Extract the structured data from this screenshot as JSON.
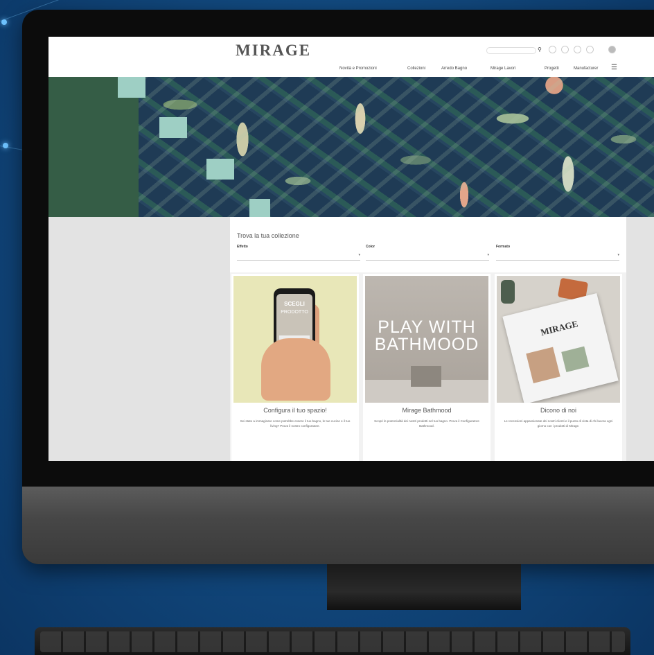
{
  "site": {
    "logo": "MIRAGE",
    "tagline": "",
    "search_placeholder": "",
    "nav": [
      "Novità e Promozioni",
      "Collezioni",
      "Arredo Bagno",
      "Mirage Lavori",
      "Progetti",
      "Manufacturer"
    ],
    "menu_icon": "hamburger-icon"
  },
  "finder": {
    "title": "Trova la tua collezione",
    "filters": [
      {
        "label": "Effetto",
        "value": ""
      },
      {
        "label": "Color",
        "value": ""
      },
      {
        "label": "Formato",
        "value": ""
      }
    ]
  },
  "cards": [
    {
      "image_text_1": "SCEGLI",
      "image_text_2": "PRODOTTO",
      "title": "Configura il tuo spazio!",
      "text": "Sei stato a immaginare come potrebbe essere il tuo bagno, le tue cucine e il tuo living? Prova il nostro configuratore."
    },
    {
      "image_text": "PLAY WITH BATHMOOD",
      "title": "Mirage Bathmood",
      "text": "Scopri le potenzialità dei nostri prodotti nel tuo bagno. Prova il Configuratore Bathmood."
    },
    {
      "image_text": "MIRAGE",
      "title": "Dicono di noi",
      "text": "Le recensioni appassionate dei nostri clienti e il punto di vista di chi lavora ogni giorno con i prodotti di Mirage."
    }
  ]
}
